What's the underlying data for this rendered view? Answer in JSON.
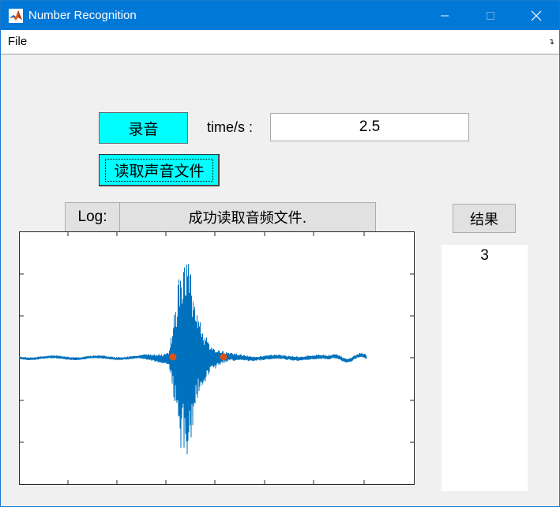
{
  "window": {
    "title": "Number Recognition",
    "titlebar_color": "#0078d7",
    "icon": "matlab-icon"
  },
  "menu": {
    "items": [
      "File"
    ]
  },
  "controls": {
    "record_button": "录音",
    "read_file_button": "读取声音文件",
    "button_color": "#00ffff",
    "time_label": "time/s :",
    "time_value": "2.5"
  },
  "log": {
    "label": "Log:",
    "message": "成功读取音频文件."
  },
  "result": {
    "button_label": "结果",
    "value": "3"
  },
  "plot": {
    "waveform_color": "#0072bd",
    "marker_color": "#d95319",
    "icon": "waveform-plot"
  }
}
